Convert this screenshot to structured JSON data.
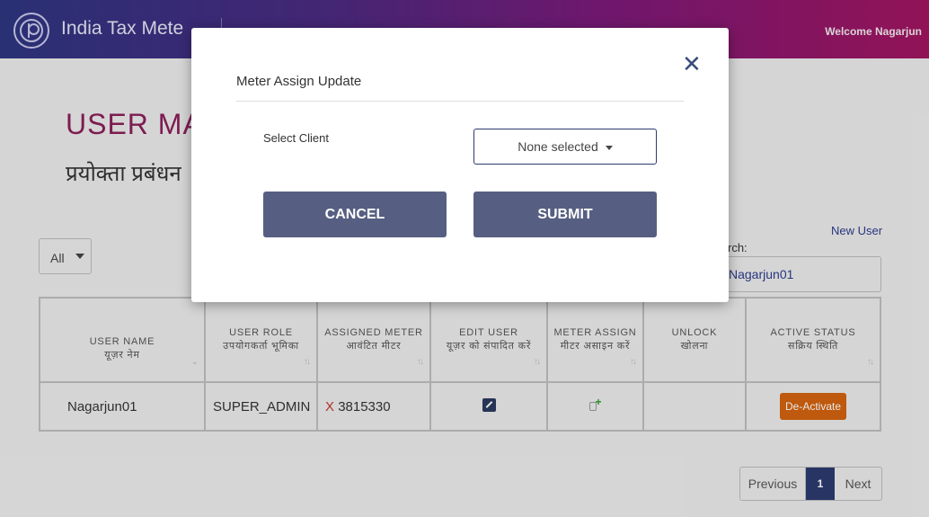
{
  "header": {
    "app_title": "India Tax Mete",
    "welcome": "Welcome Nagarjun"
  },
  "page": {
    "title": "USER MAN",
    "subtitle": "प्रयोक्ता प्रबंधन",
    "filter_value": "All",
    "new_user_link": "New User",
    "search_label": "rch:",
    "search_value": "Nagarjun01"
  },
  "table": {
    "columns": [
      {
        "en": "USER NAME",
        "hi": "यूज़र नेम"
      },
      {
        "en": "USER ROLE",
        "hi": "उपयोगकर्ता भूमिका"
      },
      {
        "en": "ASSIGNED METER",
        "hi": "आवंटित मीटर"
      },
      {
        "en": "EDIT USER",
        "hi": "यूज़र को संपादित करें"
      },
      {
        "en": "METER ASSIGN",
        "hi": "मीटर असाइन करें"
      },
      {
        "en": "UNLOCK",
        "hi": "खोलना"
      },
      {
        "en": "ACTIVE STATUS",
        "hi": "सक्रिय स्थिति"
      }
    ],
    "rows": [
      {
        "user_name": "Nagarjun01",
        "user_role": "SUPER_ADMIN",
        "meter_mark": "X",
        "meter_number": "3815330",
        "status_button": "De-Activate"
      }
    ]
  },
  "pagination": {
    "previous": "Previous",
    "current": "1",
    "next": "Next"
  },
  "modal": {
    "title": "Meter Assign Update",
    "close_glyph": "✕",
    "client_label": "Select Client",
    "client_value": "None selected",
    "cancel_label": "CANCEL",
    "submit_label": "SUBMIT"
  },
  "icons": [
    "logo-icon",
    "close-icon",
    "edit-icon",
    "assign-meter-icon",
    "sort-icon",
    "caret-down-icon"
  ],
  "colors": {
    "header_start": "#2e3580",
    "header_end": "#a0155f",
    "title": "#8a1f5a",
    "button": "#565f82",
    "deactivate": "#d1620f",
    "pager_active": "#2d3b6e"
  }
}
